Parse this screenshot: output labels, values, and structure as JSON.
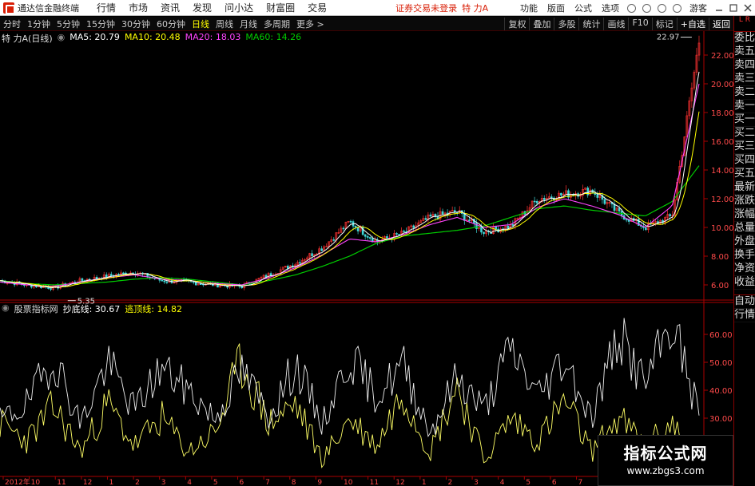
{
  "menubar": {
    "app_name": "通达信金融终端",
    "items": [
      "行情",
      "市场",
      "资讯",
      "发现",
      "问小达",
      "财富圈",
      "交易"
    ],
    "warning": "证券交易未登录",
    "stock_name": "特 力A",
    "right_items": [
      "功能",
      "版面",
      "公式",
      "选项"
    ],
    "guest": "游客"
  },
  "toolbar": {
    "periods": [
      "分时",
      "1分钟",
      "5分钟",
      "15分钟",
      "30分钟",
      "60分钟",
      "日线",
      "周线",
      "月线",
      "多周期",
      "更多 >"
    ],
    "active": "日线",
    "right": [
      "复权",
      "叠加",
      "多股",
      "统计",
      "画线",
      "F10",
      "标记",
      "+自选",
      "返回"
    ]
  },
  "rightpanel": {
    "head": "L R",
    "items": [
      "委比",
      "卖五",
      "卖四",
      "卖三",
      "卖二",
      "卖一",
      "买一",
      "买二",
      "买三",
      "买四",
      "买五",
      "最新",
      "涨跌",
      "涨幅",
      "总量",
      "外盘",
      "换手",
      "净资",
      "收益"
    ],
    "bottom": [
      "自动",
      "行情"
    ]
  },
  "main_legend": {
    "name": "特 力A(日线)",
    "ma5": "MA5: 20.79",
    "ma10": "MA10: 20.48",
    "ma20": "MA20: 18.03",
    "ma60": "MA60: 14.26"
  },
  "annotations": {
    "high": "22.97",
    "low": "5.35"
  },
  "indicator_legend": {
    "name": "股票指标网",
    "line1": "抄底线: 30.67",
    "line2": "逃顶线: 14.82"
  },
  "watermark": {
    "title": "指标公式网",
    "url": "www.zbgs3.com"
  },
  "colors": {
    "up": "#ff3232",
    "down": "#3fd8d8",
    "ma5": "#ffffff",
    "ma10": "#ffff00",
    "ma20": "#ff44ff",
    "ma60": "#00cc00",
    "axis": "#ff4a4a"
  },
  "chart_data": [
    {
      "type": "line",
      "title": "特 力A(日线)",
      "y_ticks": [
        6,
        8,
        10,
        12,
        14,
        16,
        18,
        20,
        22
      ],
      "ylim": [
        5,
        23
      ],
      "x_labels": [
        "2012年",
        "10",
        "11",
        "12",
        "1",
        "2",
        "3",
        "4",
        "5",
        "6",
        "7",
        "8",
        "9",
        "10",
        "11",
        "12",
        "1",
        "2",
        "3",
        "4",
        "5",
        "6",
        "7",
        "8",
        "9",
        "10",
        "11"
      ],
      "series": [
        {
          "name": "MA60",
          "values": [
            6.3,
            6.1,
            6.0,
            6.1,
            6.2,
            6.4,
            6.5,
            6.4,
            6.2,
            6.0,
            6.3,
            6.7,
            7.3,
            8.0,
            8.9,
            9.4,
            9.6,
            9.8,
            10.1,
            10.7,
            11.3,
            11.5,
            11.2,
            11.0,
            10.8,
            11.8,
            14.3
          ]
        },
        {
          "name": "MA20",
          "values": [
            6.2,
            6.0,
            5.9,
            6.2,
            6.5,
            6.7,
            6.4,
            6.3,
            6.1,
            6.0,
            6.5,
            7.2,
            8.1,
            9.2,
            9.0,
            9.5,
            10.2,
            10.7,
            10.0,
            10.2,
            11.4,
            12.0,
            11.5,
            10.9,
            10.0,
            11.5,
            20.0
          ]
        },
        {
          "name": "收盘",
          "values": [
            6.3,
            6.0,
            5.8,
            6.3,
            6.6,
            6.9,
            6.3,
            6.2,
            6.0,
            5.9,
            6.7,
            7.5,
            8.6,
            10.4,
            9.0,
            9.6,
            10.7,
            11.1,
            9.7,
            10.1,
            12.0,
            12.3,
            12.6,
            11.0,
            10.0,
            10.8,
            22.97
          ]
        }
      ]
    },
    {
      "type": "line",
      "title": "股票指标网",
      "y_ticks": [
        20,
        30,
        40,
        50,
        60
      ],
      "ylim": [
        10,
        70
      ],
      "series": [
        {
          "name": "抄底线",
          "values": [
            29,
            35,
            52,
            28,
            50,
            33,
            48,
            40,
            30,
            47,
            31,
            49,
            28,
            52,
            38,
            49,
            25,
            45,
            33,
            55,
            38,
            52,
            30,
            60,
            42,
            65,
            30.67
          ]
        },
        {
          "name": "逃顶线",
          "values": [
            28,
            22,
            34,
            18,
            35,
            20,
            30,
            18,
            25,
            50,
            28,
            35,
            15,
            30,
            20,
            40,
            18,
            42,
            15,
            30,
            22,
            36,
            18,
            30,
            20,
            28,
            14.82
          ]
        }
      ]
    }
  ]
}
